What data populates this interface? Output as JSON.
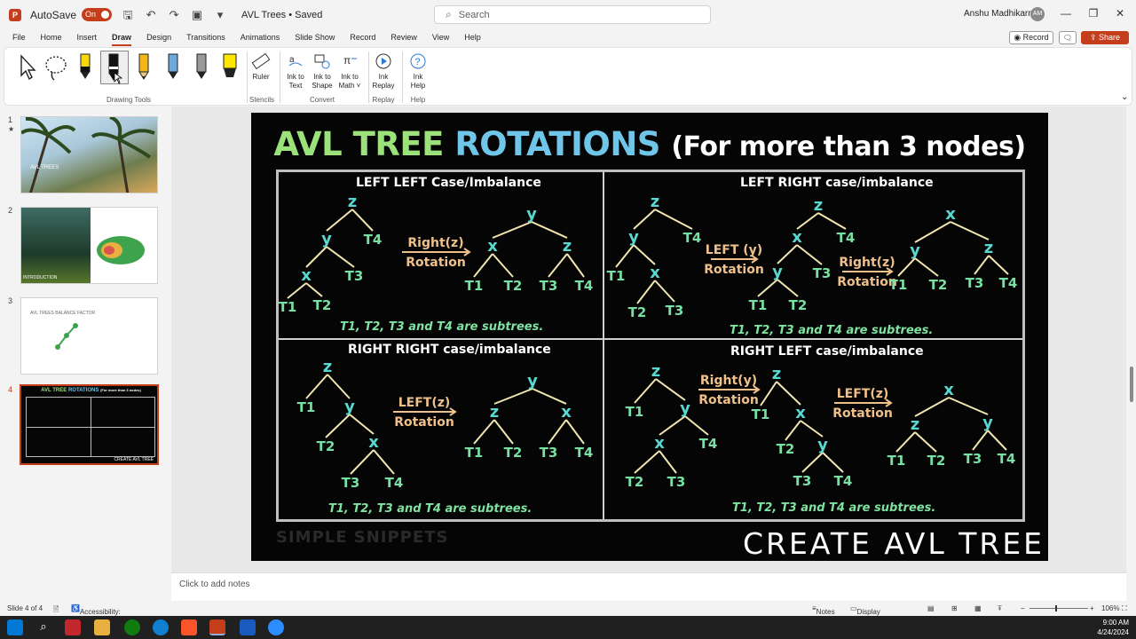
{
  "titlebar": {
    "autosave_label": "AutoSave",
    "autosave_state": "On",
    "doc_title": "AVL Trees • Saved",
    "search_placeholder": "Search",
    "user_name": "Anshu Madhikarmi",
    "user_initials": "AM"
  },
  "menu": {
    "tabs": [
      "File",
      "Home",
      "Insert",
      "Draw",
      "Design",
      "Transitions",
      "Animations",
      "Slide Show",
      "Record",
      "Review",
      "View",
      "Help"
    ],
    "active_tab": "Draw",
    "record_button": "Record",
    "share_button": "Share"
  },
  "ribbon": {
    "groups": {
      "drawing_tools": "Drawing Tools",
      "stencils": "Stencils",
      "convert": "Convert",
      "replay": "Replay",
      "help": "Help"
    },
    "buttons": {
      "ruler": "Ruler",
      "ink_to_text": "Ink to Text",
      "ink_to_shape": "Ink to Shape",
      "ink_to_math": "Ink to Math ˅",
      "ink_replay": "Ink Replay",
      "ink_help": "Ink Help"
    }
  },
  "thumbnails": {
    "numbers": [
      "1",
      "2",
      "3",
      "4"
    ],
    "slide1_title": "AVL TREES",
    "slide2_caption": "INTRODUCTION",
    "slide3_title": "AVL TREES BALANCE FACTOR",
    "slide4_caption": "CREATE AVL TREE"
  },
  "slide": {
    "title_part1": "AVL TREE",
    "title_part2": "ROTATIONS",
    "title_part3": "(For more than 3 nodes)",
    "cases": {
      "ll": "LEFT LEFT Case/Imbalance",
      "lr": "LEFT RIGHT case/imbalance",
      "rr": "RIGHT RIGHT case/imbalance",
      "rl": "RIGHT LEFT case/imbalance"
    },
    "subtree_note": "T1, T2, T3 and T4 are subtrees.",
    "rotations": {
      "right_z": "Right(z)",
      "rotation": "Rotation",
      "left_y": "LEFT (y)",
      "left_z": "LEFT(z)",
      "right_y": "Right(y)"
    },
    "watermark": "SIMPLE SNIPPETS",
    "overlay_caption": "CREATE AVL TREE"
  },
  "notes_placeholder": "Click to add notes",
  "status": {
    "slide_info": "Slide 4 of 4",
    "accessibility": "Accessibility: Investigate",
    "notes": "Notes",
    "display_settings": "Display Settings",
    "zoom": "106%"
  },
  "taskbar": {
    "time": "9:00 AM",
    "date": "4/24/2024"
  },
  "colors": {
    "brand": "#c43e1c",
    "node": "#58d8d0",
    "subtree": "#79e0a4",
    "rotation_text": "#f0c08a"
  }
}
